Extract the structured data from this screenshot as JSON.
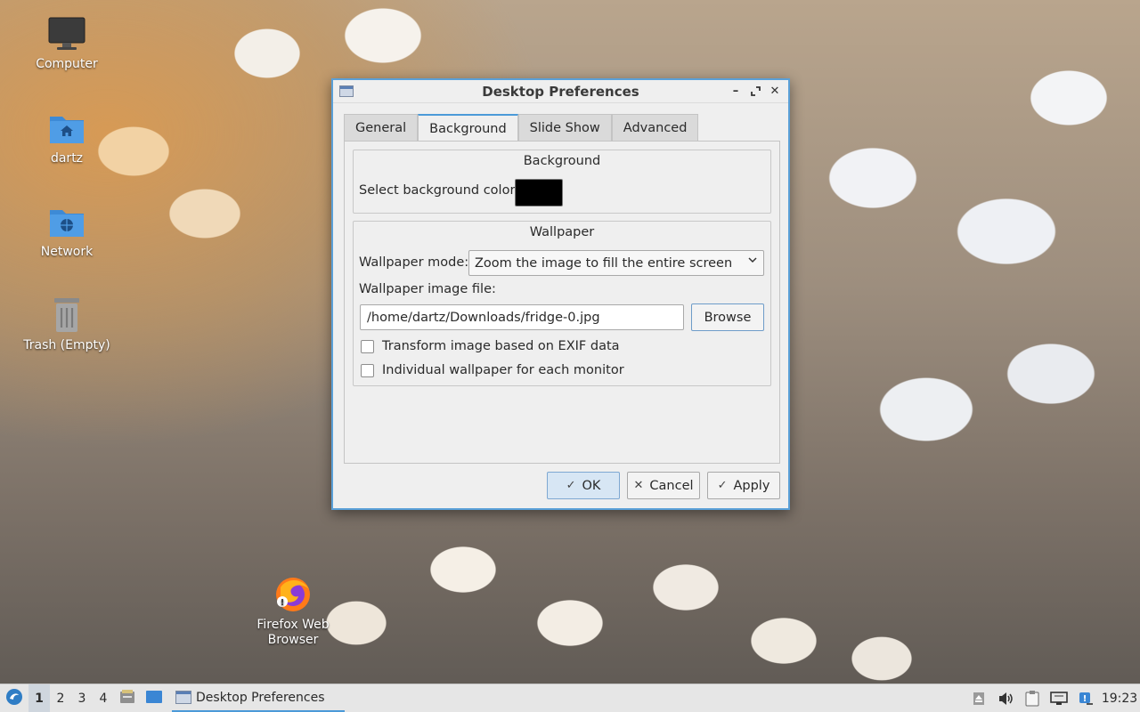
{
  "desktop": {
    "icons": [
      {
        "label": "Computer",
        "icon": "monitor-icon"
      },
      {
        "label": "dartz",
        "icon": "home-folder-icon"
      },
      {
        "label": "Network",
        "icon": "network-folder-icon"
      },
      {
        "label": "Trash (Empty)",
        "icon": "trash-icon"
      },
      {
        "label": "Firefox Web Browser",
        "icon": "firefox-icon"
      }
    ]
  },
  "dialog": {
    "title": "Desktop Preferences",
    "tabs": [
      {
        "label": "General",
        "active": false
      },
      {
        "label": "Background",
        "active": true
      },
      {
        "label": "Slide Show",
        "active": false
      },
      {
        "label": "Advanced",
        "active": false
      }
    ],
    "background_group": {
      "title": "Background",
      "color_label": "Select background color:",
      "color_value": "#000000"
    },
    "wallpaper_group": {
      "title": "Wallpaper",
      "mode_label": "Wallpaper mode:",
      "mode_value": "Zoom the image to fill the entire screen",
      "file_label": "Wallpaper image file:",
      "file_value": "/home/dartz/Downloads/fridge-0.jpg",
      "browse_label": "Browse",
      "exif_label": "Transform image based on EXIF data",
      "exif_checked": false,
      "per_monitor_label": "Individual wallpaper for each monitor",
      "per_monitor_checked": false
    },
    "buttons": {
      "ok": "OK",
      "cancel": "Cancel",
      "apply": "Apply"
    }
  },
  "taskbar": {
    "workspaces": [
      "1",
      "2",
      "3",
      "4"
    ],
    "active_workspace": "1",
    "task_label": "Desktop Preferences",
    "clock": "19:23"
  }
}
